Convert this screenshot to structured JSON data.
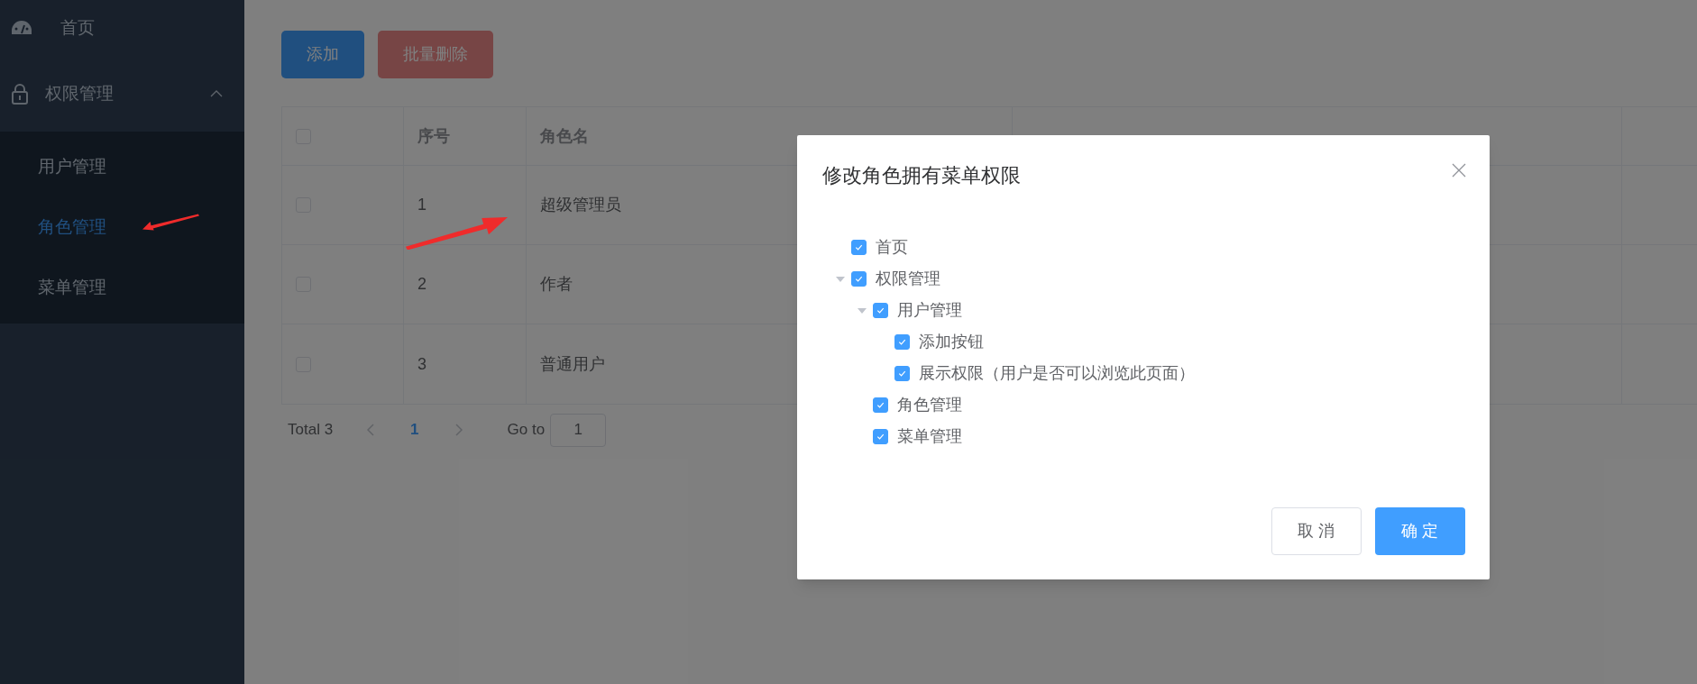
{
  "sidebar": {
    "items": [
      {
        "label": "首页"
      },
      {
        "label": "权限管理",
        "expanded": true,
        "children": [
          {
            "label": "用户管理",
            "selected": false
          },
          {
            "label": "角色管理",
            "selected": true
          },
          {
            "label": "菜单管理",
            "selected": false
          }
        ]
      }
    ]
  },
  "toolbar": {
    "buttons": [
      {
        "label": "添加",
        "kind": "primary",
        "disabled": false
      },
      {
        "label": "批量删除",
        "kind": "danger",
        "disabled": true
      }
    ]
  },
  "table": {
    "header_checked": false,
    "columns": [
      "序号",
      "角色名"
    ],
    "rows": [
      {
        "checked": false,
        "cells": [
          "1",
          "超级管理员"
        ]
      },
      {
        "checked": false,
        "cells": [
          "2",
          "作者"
        ]
      },
      {
        "checked": false,
        "cells": [
          "3",
          "普通用户"
        ]
      }
    ]
  },
  "pagination": {
    "total": "Total 3",
    "pages": [
      {
        "label": "1",
        "selected": true
      }
    ],
    "goto_label": "Go to",
    "goto_value": "1"
  },
  "dialog": {
    "title": "修改角色拥有菜单权限",
    "tree": [
      {
        "label": "首页",
        "checked": true
      },
      {
        "label": "权限管理",
        "checked": true,
        "expanded": true,
        "children": [
          {
            "label": "用户管理",
            "checked": true,
            "expanded": true,
            "children": [
              {
                "label": "添加按钮",
                "checked": true
              },
              {
                "label": "展示权限（用户是否可以浏览此页面）",
                "checked": true
              }
            ]
          },
          {
            "label": "角色管理",
            "checked": true
          },
          {
            "label": "菜单管理",
            "checked": true
          }
        ]
      }
    ],
    "buttons": [
      {
        "label": "取 消",
        "kind": "default"
      },
      {
        "label": "确 定",
        "kind": "primary"
      }
    ]
  }
}
